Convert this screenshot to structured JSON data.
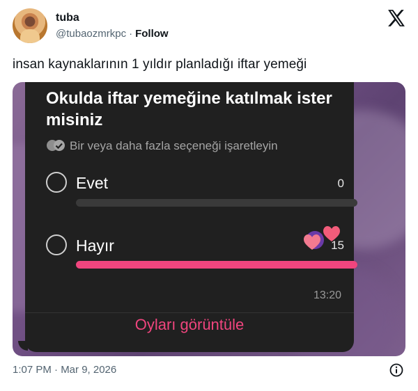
{
  "author": {
    "name": "tuba",
    "handle": "@tubaozmrkpc",
    "separator": "·",
    "follow_label": "Follow",
    "avatar_icon": "user-avatar-photo"
  },
  "tweet": {
    "text": "insan kaynaklarının 1 yıldır planladığı iftar yemeği",
    "timestamp": "1:07 PM · Mar 9, 2026"
  },
  "poll": {
    "question": "Okulda iftar yemeğine katılmak ister misiniz",
    "hint": "Bir veya daha fazla seçeneği işaretleyin",
    "options": [
      {
        "label": "Evet",
        "count": "0",
        "fraction": 0.0
      },
      {
        "label": "Hayır",
        "count": "15",
        "fraction": 1.0
      }
    ],
    "time": "13:20",
    "view_votes_label": "Oyları görüntüle",
    "accent_color": "#f0457e"
  },
  "icons": {
    "logo": "x-logo-icon",
    "info": "info-icon",
    "checks": "double-check-icon"
  }
}
